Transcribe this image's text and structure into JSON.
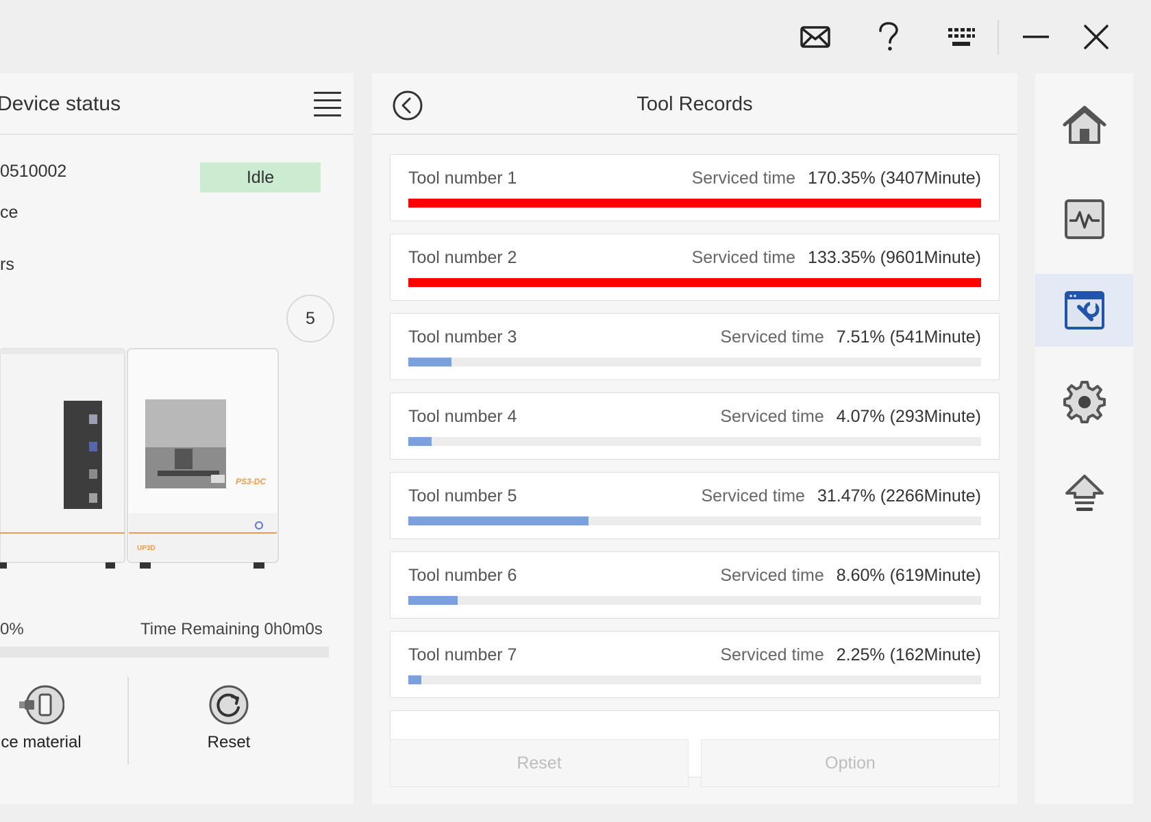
{
  "titlebar": {
    "icons": [
      "mail-icon",
      "help-icon",
      "keyboard-icon",
      "minimize-icon",
      "close-icon"
    ]
  },
  "device_panel": {
    "title": "Device status",
    "serial": "0510002",
    "status": "Idle",
    "row_1": "ce",
    "row_2": "rs",
    "count": "5",
    "machine_label": "PS3-DC",
    "brand": "UP3D",
    "progress_text": "0%",
    "progress": 0,
    "time_remaining": "Time Remaining 0h0m0s",
    "actions": [
      {
        "label": "ce material",
        "icon": "material-icon"
      },
      {
        "label": "Reset",
        "icon": "reset-icon"
      }
    ]
  },
  "tool_panel": {
    "title": "Tool Records",
    "serviced_label": "Serviced time",
    "records": [
      {
        "name": "Tool number 1",
        "value": "170.35% (3407Minute)",
        "percent": 170.35
      },
      {
        "name": "Tool number 2",
        "value": "133.35% (9601Minute)",
        "percent": 133.35
      },
      {
        "name": "Tool number 3",
        "value": "7.51% (541Minute)",
        "percent": 7.51
      },
      {
        "name": "Tool number 4",
        "value": "4.07% (293Minute)",
        "percent": 4.07
      },
      {
        "name": "Tool number 5",
        "value": "31.47% (2266Minute)",
        "percent": 31.47
      },
      {
        "name": "Tool number 6",
        "value": "8.60% (619Minute)",
        "percent": 8.6
      },
      {
        "name": "Tool number 7",
        "value": "2.25% (162Minute)",
        "percent": 2.25
      }
    ],
    "buttons": {
      "reset": "Reset",
      "option": "Option"
    }
  },
  "nav": {
    "items": [
      "home-icon",
      "monitor-icon",
      "tool-maintenance-icon",
      "settings-icon",
      "upload-icon"
    ],
    "active": "tool-maintenance-icon"
  },
  "colors": {
    "over_limit": "#ff0000",
    "normal_bar": "#7aa0de",
    "idle_badge": "#ccecd2",
    "nav_active": "#e3eaf6",
    "machine_accent": "#f29a4a"
  }
}
